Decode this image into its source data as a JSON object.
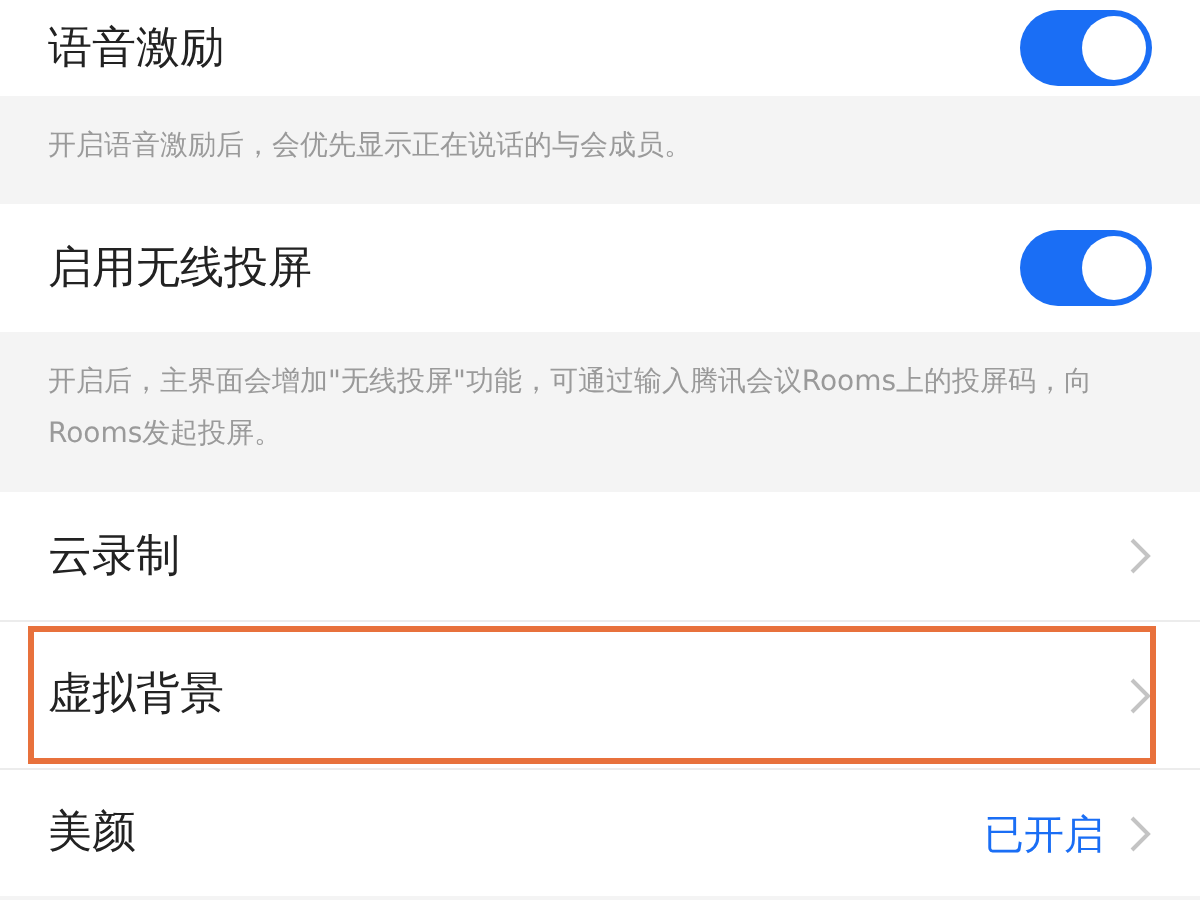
{
  "settings": [
    {
      "kind": "toggle",
      "label": "语音激励",
      "on": true,
      "description": "开启语音激励后，会优先显示正在说话的与会成员。",
      "highlighted": false
    },
    {
      "kind": "toggle",
      "label": "启用无线投屏",
      "on": true,
      "description": "开启后，主界面会增加\"无线投屏\"功能，可通过输入腾讯会议Rooms上的投屏码，向Rooms发起投屏。",
      "highlighted": false
    },
    {
      "kind": "link",
      "label": "云录制",
      "highlighted": false
    },
    {
      "kind": "link",
      "label": "虚拟背景",
      "highlighted": true
    },
    {
      "kind": "link",
      "label": "美颜",
      "value": "已开启",
      "highlighted": false
    }
  ]
}
